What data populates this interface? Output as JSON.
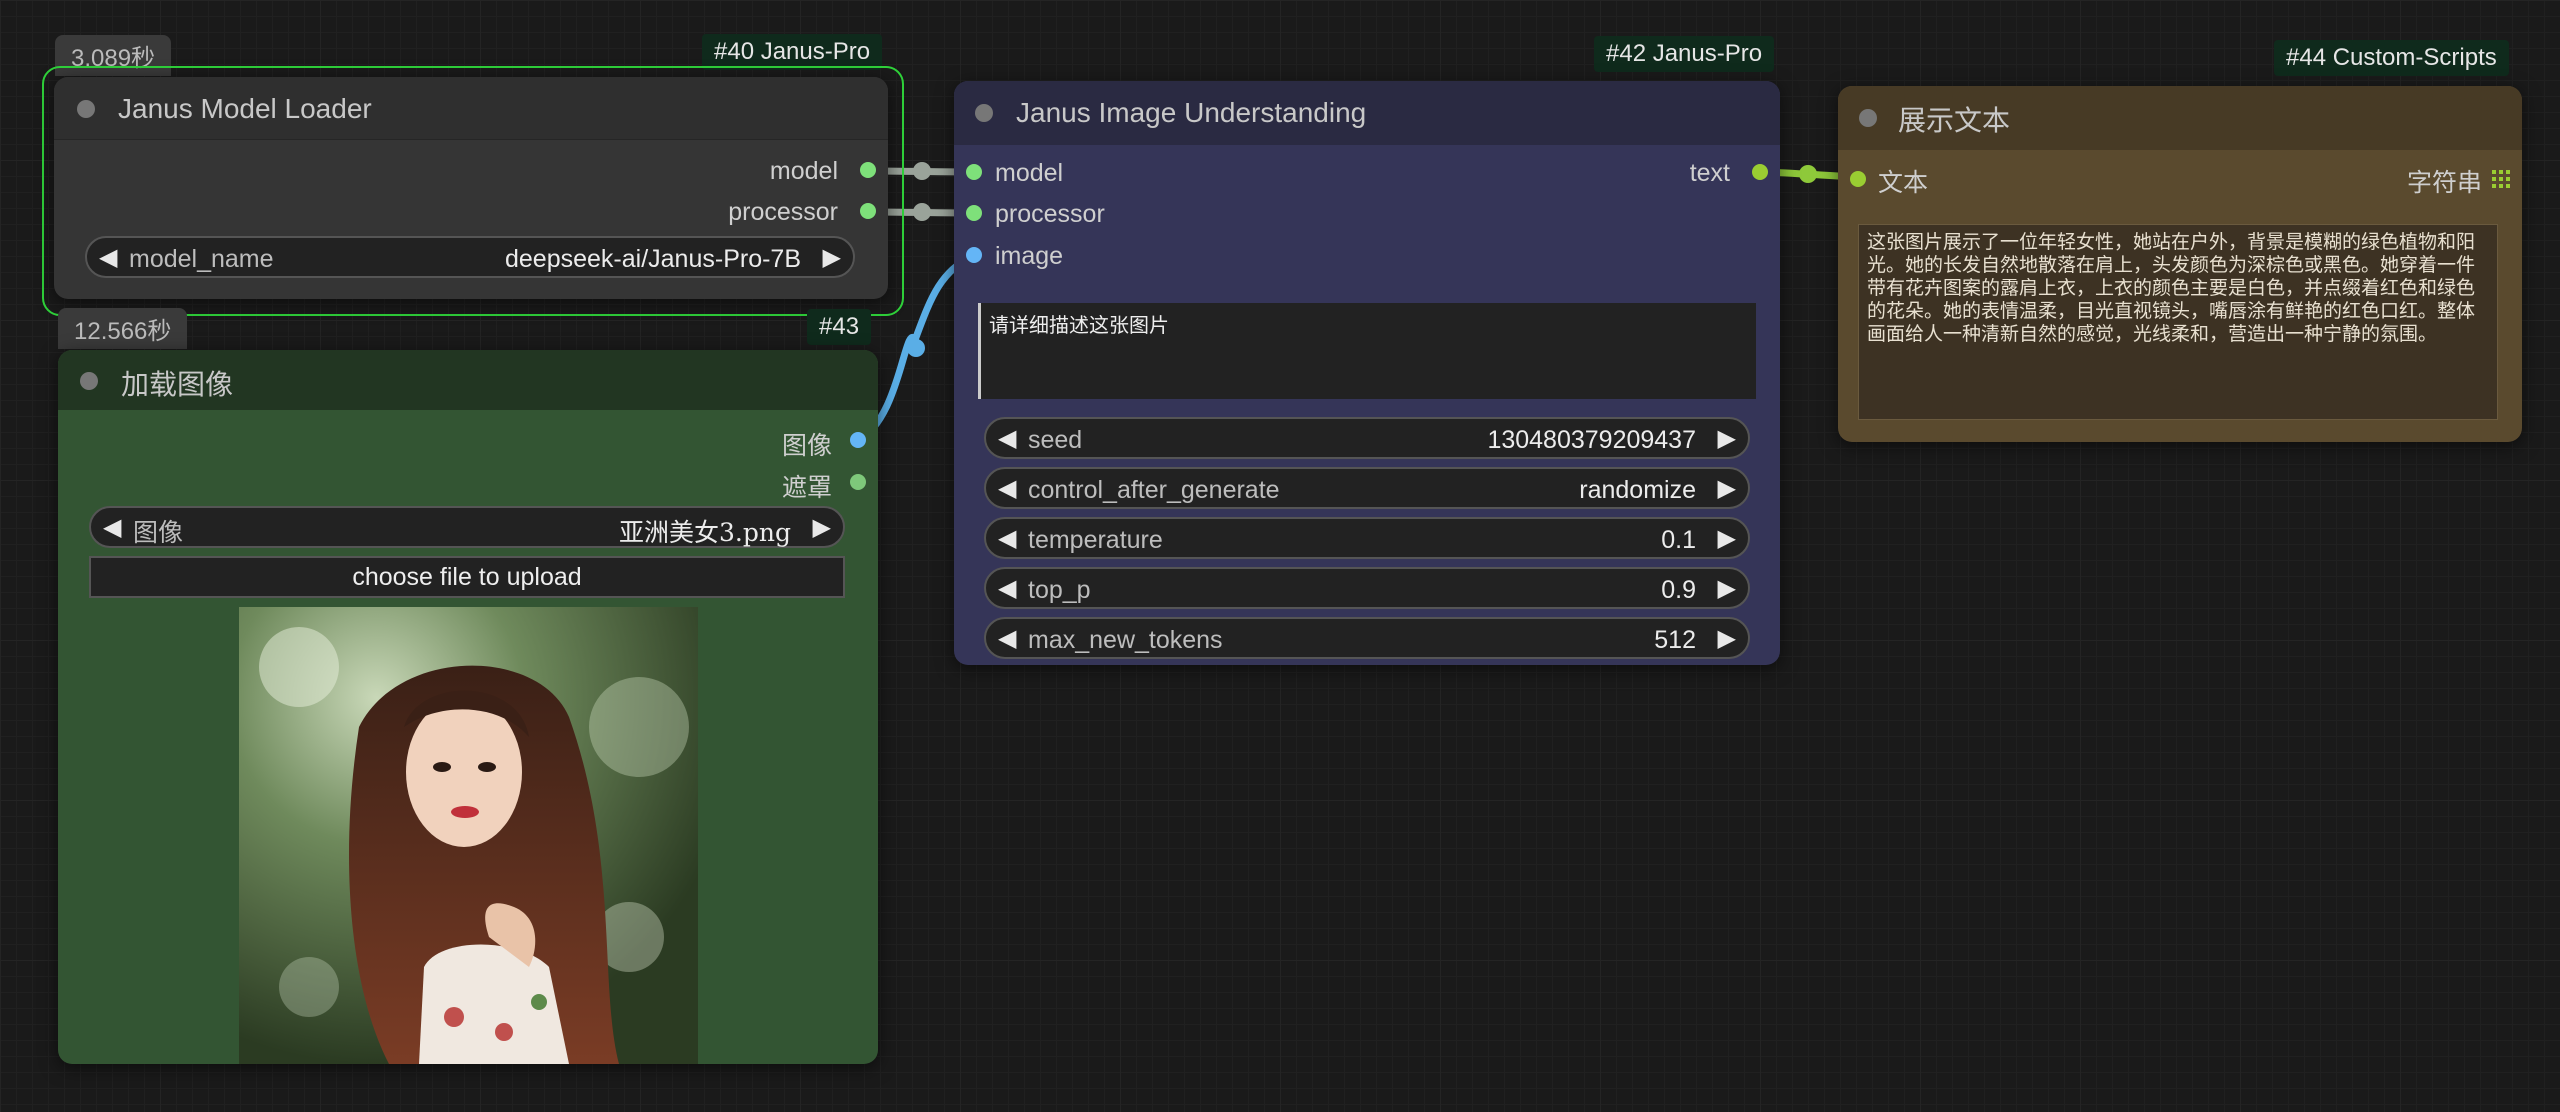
{
  "nodes": {
    "loader": {
      "time": "3.089秒",
      "badge": "#40 Janus-Pro",
      "title": "Janus Model Loader",
      "outputs": [
        "model",
        "processor"
      ],
      "widget": {
        "label": "model_name",
        "value": "deepseek-ai/Janus-Pro-7B"
      }
    },
    "load_image": {
      "time": "12.566秒",
      "badge": "#43",
      "title": "加载图像",
      "outputs": [
        "图像",
        "遮罩"
      ],
      "widget": {
        "label": "图像",
        "value": "亚洲美女3.png"
      },
      "upload_label": "choose file to upload"
    },
    "understanding": {
      "badge": "#42 Janus-Pro",
      "title": "Janus Image Understanding",
      "inputs": [
        "model",
        "processor",
        "image"
      ],
      "output": "text",
      "prompt": "请详细描述这张图片",
      "widgets": [
        {
          "label": "seed",
          "value": "130480379209437"
        },
        {
          "label": "control_after_generate",
          "value": "randomize"
        },
        {
          "label": "temperature",
          "value": "0.1"
        },
        {
          "label": "top_p",
          "value": "0.9"
        },
        {
          "label": "max_new_tokens",
          "value": "512"
        }
      ]
    },
    "show_text": {
      "badge": "#44 Custom-Scripts",
      "title": "展示文本",
      "input": "文本",
      "type_label": "字符串",
      "text": "这张图片展示了一位年轻女性，她站在户外，背景是模糊的绿色植物和阳光。她的长发自然地散落在肩上，头发颜色为深棕色或黑色。她穿着一件带有花卉图案的露肩上衣，上衣的颜色主要是白色，并点缀着红色和绿色的花朵。她的表情温柔，目光直视镜头，嘴唇涂有鲜艳的红色口红。整体画面给人一种清新自然的感觉，光线柔和，营造出一种宁静的氛围。"
    }
  },
  "colors": {
    "model_slot": "#7ee07a",
    "image_slot": "#64b5f6",
    "string_slot": "#9acd32",
    "link_gray": "#9aa39a",
    "link_blue": "#5aaee6",
    "link_green": "#8ec93a",
    "selected_outline": "#2fd23a"
  }
}
